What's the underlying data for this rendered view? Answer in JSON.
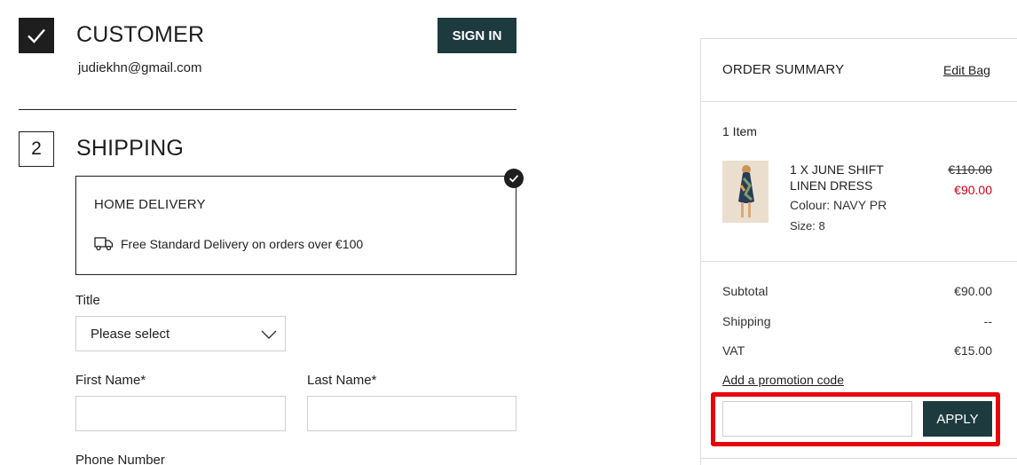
{
  "customer": {
    "title": "CUSTOMER",
    "email": "judiekhn@gmail.com",
    "sign_in_label": "SIGN IN"
  },
  "shipping": {
    "step_number": "2",
    "title": "SHIPPING",
    "delivery_option": {
      "title": "HOME DELIVERY",
      "description": "Free Standard Delivery on orders over €100",
      "selected": true
    },
    "form": {
      "title_label": "Title",
      "title_value": "Please select",
      "first_name_label": "First Name*",
      "last_name_label": "Last Name*",
      "phone_label": "Phone Number"
    }
  },
  "summary": {
    "title": "ORDER SUMMARY",
    "edit_bag_label": "Edit Bag",
    "item_count": "1 Item",
    "item": {
      "name": "1 X JUNE SHIFT LINEN DRESS",
      "colour": "Colour: NAVY PR",
      "size": "Size: 8",
      "original_price": "€110.00",
      "sale_price": "€90.00"
    },
    "rows": [
      {
        "label": "Subtotal",
        "value": "€90.00"
      },
      {
        "label": "Shipping",
        "value": "--"
      },
      {
        "label": "VAT",
        "value": "€15.00"
      }
    ],
    "promo_link_label": "Add a promotion code",
    "apply_label": "APPLY"
  },
  "colors": {
    "accent": "#1d3a3f",
    "sale_red": "#d0021b",
    "highlight_red": "#e8000b"
  }
}
